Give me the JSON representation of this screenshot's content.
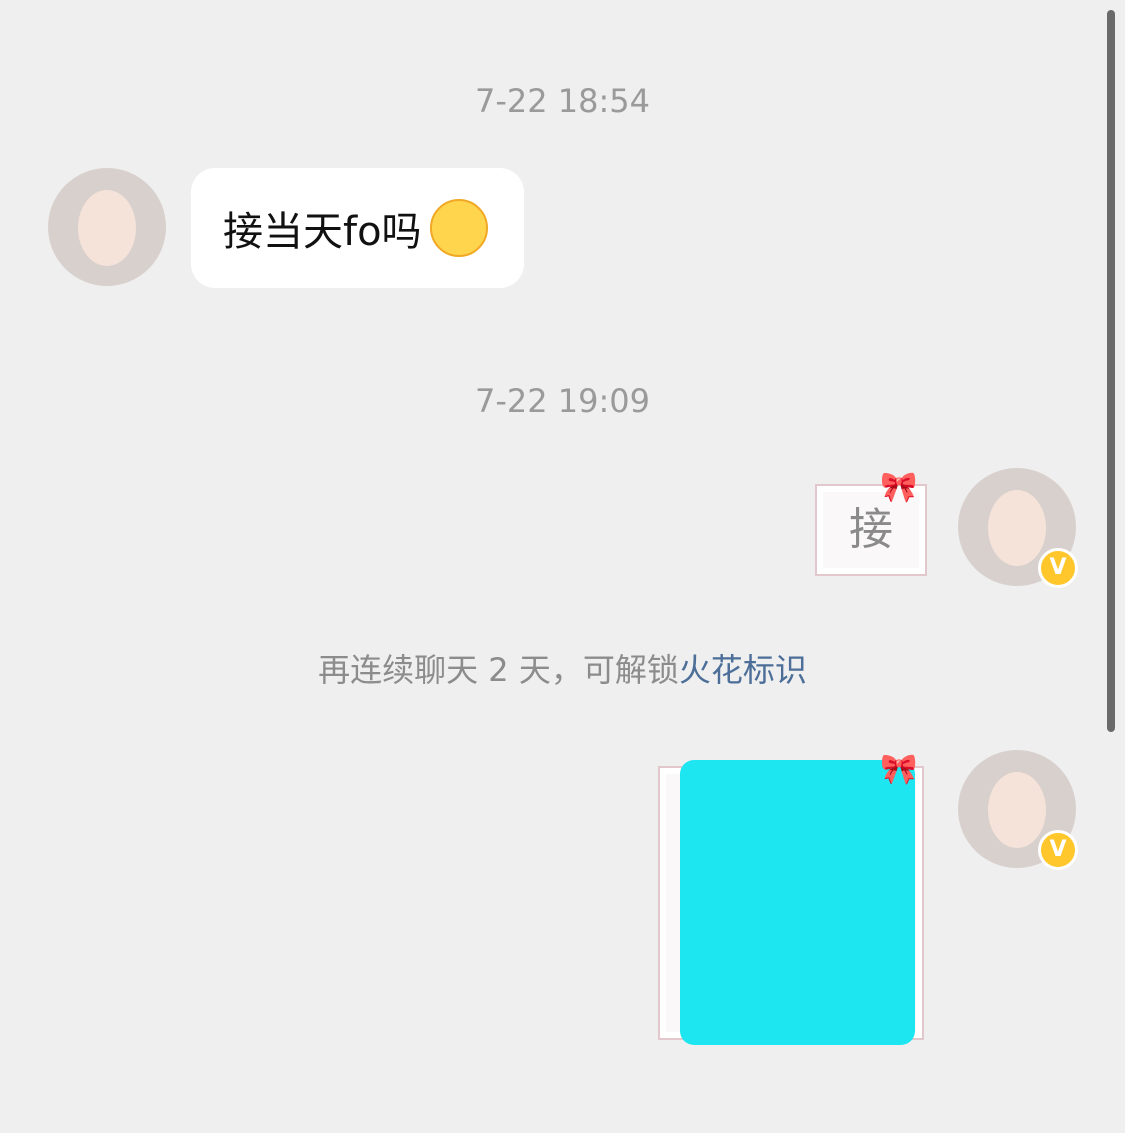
{
  "messages": [
    {
      "time": "7-22 18:54"
    },
    {
      "text": "接当天fo吗"
    },
    {
      "time": "7-22 19:09"
    },
    {
      "sticker": "接"
    }
  ],
  "system": {
    "prefix": "再连续聊天 2 天，可解锁",
    "link": "火花标识"
  },
  "icons": {
    "emoji": "heart-face-emoji",
    "badge": "v-badge-icon"
  }
}
